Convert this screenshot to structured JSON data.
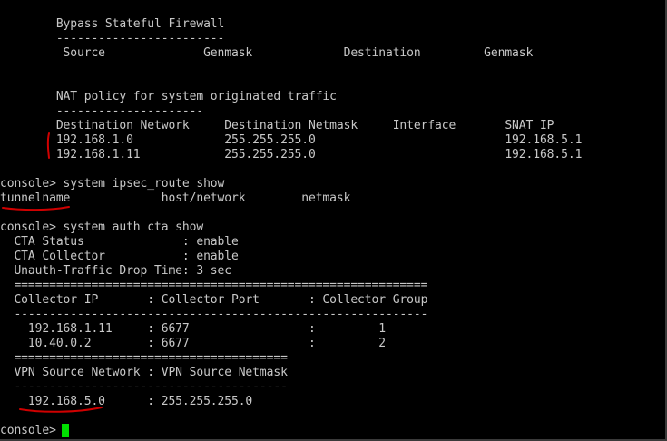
{
  "terminal": {
    "lines": [
      "        Bypass Stateful Firewall",
      "        ------------------------",
      "         Source              Genmask             Destination         Genmask",
      "",
      "",
      "        NAT policy for system originated traffic",
      "        ---------------------",
      "        Destination Network     Destination Netmask     Interface       SNAT IP",
      "        192.168.1.0             255.255.255.0                           192.168.5.1",
      "        192.168.1.11            255.255.255.0                           192.168.5.1",
      "",
      "console> system ipsec_route show",
      "tunnelname             host/network        netmask",
      "",
      "console> system auth cta show",
      "  CTA Status              : enable",
      "  CTA Collector           : enable",
      "  Unauth-Traffic Drop Time: 3 sec",
      "  ===========================================================",
      "  Collector IP       : Collector Port       : Collector Group",
      "  -----------------------------------------------------------",
      "    192.168.1.11     : 6677                 :         1",
      "    10.40.0.2        : 6677                 :         2",
      "  =======================================",
      "  VPN Source Network : VPN Source Netmask",
      "  ---------------------------------------",
      "    192.168.5.0      : 255.255.255.0",
      "",
      "console> "
    ]
  },
  "colors": {
    "background": "#000000",
    "text": "#c8c8c8",
    "cursor": "#00e000",
    "annotation": "#d00000"
  }
}
